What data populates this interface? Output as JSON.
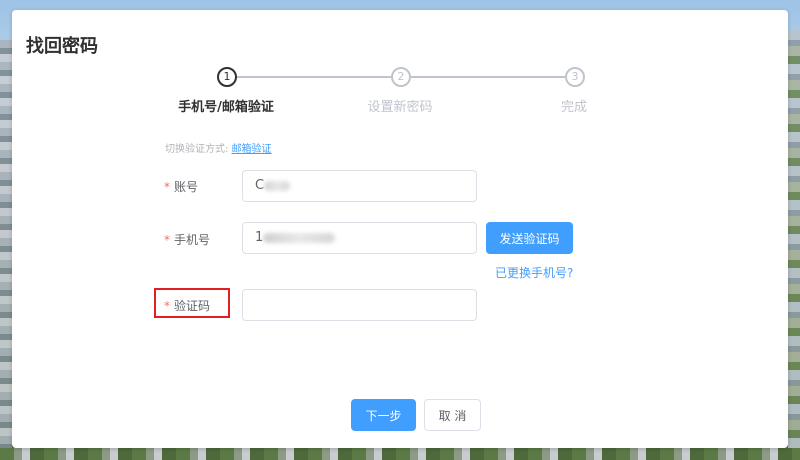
{
  "dialog": {
    "title": "找回密码"
  },
  "steps": [
    {
      "number": "1",
      "label": "手机号/邮箱验证",
      "active": true
    },
    {
      "number": "2",
      "label": "设置新密码",
      "active": false
    },
    {
      "number": "3",
      "label": "完成",
      "active": false
    }
  ],
  "switch_method": {
    "prefix": "切换验证方式:",
    "link": "邮箱验证"
  },
  "form": {
    "required_mark": "*",
    "account": {
      "label": "账号",
      "value": "C"
    },
    "phone": {
      "label": "手机号",
      "value": "1"
    },
    "code": {
      "label": "验证码",
      "value": "",
      "placeholder": ""
    },
    "send_code_label": "发送验证码",
    "changed_phone_link": "已更换手机号?"
  },
  "footer": {
    "next_label": "下一步",
    "cancel_label": "取 消"
  },
  "colors": {
    "primary": "#409eff",
    "required": "#f56c6c",
    "highlight_box": "#e02020"
  }
}
